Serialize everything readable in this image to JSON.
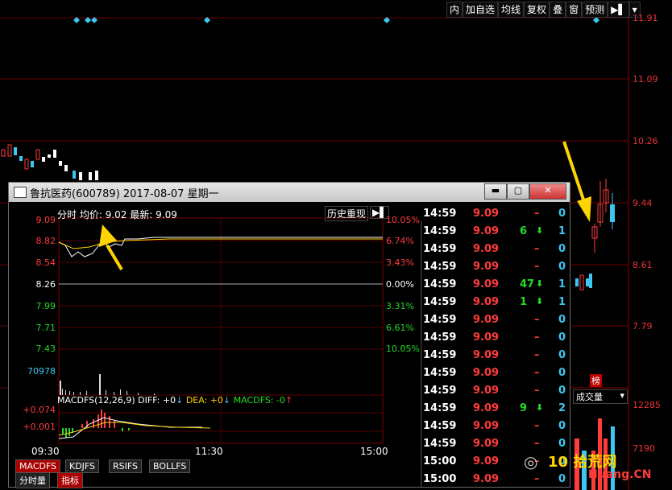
{
  "toolbar": {
    "items": [
      "内",
      "加自选",
      "均线",
      "复权",
      "叠",
      "窗",
      "预测",
      "▶▌",
      "▾"
    ]
  },
  "main_axis": {
    "prices": [
      "11.91",
      "11.09",
      "10.26",
      "9.44",
      "8.61",
      "7.79"
    ]
  },
  "volume": {
    "selector": "成交量",
    "label_12285": "12285",
    "badge": "榜",
    "label_bottom": "7190"
  },
  "popup": {
    "title": "鲁抗医药(600789) 2017-08-07 星期一",
    "btn_min": "▬",
    "btn_max": "▢",
    "btn_close": "✕",
    "header": {
      "fen_shi": "分时",
      "avg_label": "均价:",
      "avg": "9.02",
      "last_label": "最新:",
      "last": "9.09",
      "history": "历史重现",
      "arrow": "▶▌"
    },
    "price_axis": [
      "9.09",
      "8.82",
      "8.54",
      "8.26",
      "7.99",
      "7.71",
      "7.43"
    ],
    "pct_axis": [
      "10.05%",
      "6.74%",
      "3.43%",
      "0.00%",
      "3.31%",
      "6.61%",
      "10.05%"
    ],
    "volume_max": "70978",
    "macd": {
      "label": "MACDFS(12,26,9)",
      "diff_label": "DIFF: +0",
      "dea_label": "DEA: +0",
      "macdfs_label": "MACDFS: -0",
      "axis_top": "+0.074",
      "axis_mid": "+0.001"
    },
    "time_axis": [
      "09:30",
      "11:30",
      "15:00"
    ],
    "tabs": [
      "MACDFS",
      "KDJFS",
      "RSIFS",
      "BOLLFS"
    ],
    "bottom_tabs": [
      "分时量",
      "指标"
    ],
    "ticks": [
      {
        "time": "14:59",
        "price": "9.09",
        "vol": "–",
        "dir": "",
        "n": "0"
      },
      {
        "time": "14:59",
        "price": "9.09",
        "vol": "6",
        "dir": "down",
        "n": "1"
      },
      {
        "time": "14:59",
        "price": "9.09",
        "vol": "–",
        "dir": "",
        "n": "0"
      },
      {
        "time": "14:59",
        "price": "9.09",
        "vol": "–",
        "dir": "",
        "n": "0"
      },
      {
        "time": "14:59",
        "price": "9.09",
        "vol": "47",
        "dir": "down",
        "n": "1"
      },
      {
        "time": "14:59",
        "price": "9.09",
        "vol": "1",
        "dir": "down",
        "n": "1"
      },
      {
        "time": "14:59",
        "price": "9.09",
        "vol": "–",
        "dir": "",
        "n": "0"
      },
      {
        "time": "14:59",
        "price": "9.09",
        "vol": "–",
        "dir": "",
        "n": "0"
      },
      {
        "time": "14:59",
        "price": "9.09",
        "vol": "–",
        "dir": "",
        "n": "0"
      },
      {
        "time": "14:59",
        "price": "9.09",
        "vol": "–",
        "dir": "",
        "n": "0"
      },
      {
        "time": "14:59",
        "price": "9.09",
        "vol": "–",
        "dir": "",
        "n": "0"
      },
      {
        "time": "14:59",
        "price": "9.09",
        "vol": "9",
        "dir": "down",
        "n": "2"
      },
      {
        "time": "14:59",
        "price": "9.09",
        "vol": "–",
        "dir": "",
        "n": "0"
      },
      {
        "time": "14:59",
        "price": "9.09",
        "vol": "–",
        "dir": "",
        "n": "0"
      },
      {
        "time": "15:00",
        "price": "9.09",
        "vol": "–",
        "dir": "",
        "n": "0"
      },
      {
        "time": "15:00",
        "price": "9.09",
        "vol": "–",
        "dir": "",
        "n": "0"
      }
    ]
  },
  "watermark": {
    "text": "10 拾荒网",
    "sub": "Huang.CN"
  },
  "colors": {
    "up": "#ff3b3b",
    "down": "#22dd22",
    "flat": "#ffffff",
    "cyan": "#3cc7f0",
    "yellow": "#ffd400",
    "grid": "#7a0000"
  }
}
